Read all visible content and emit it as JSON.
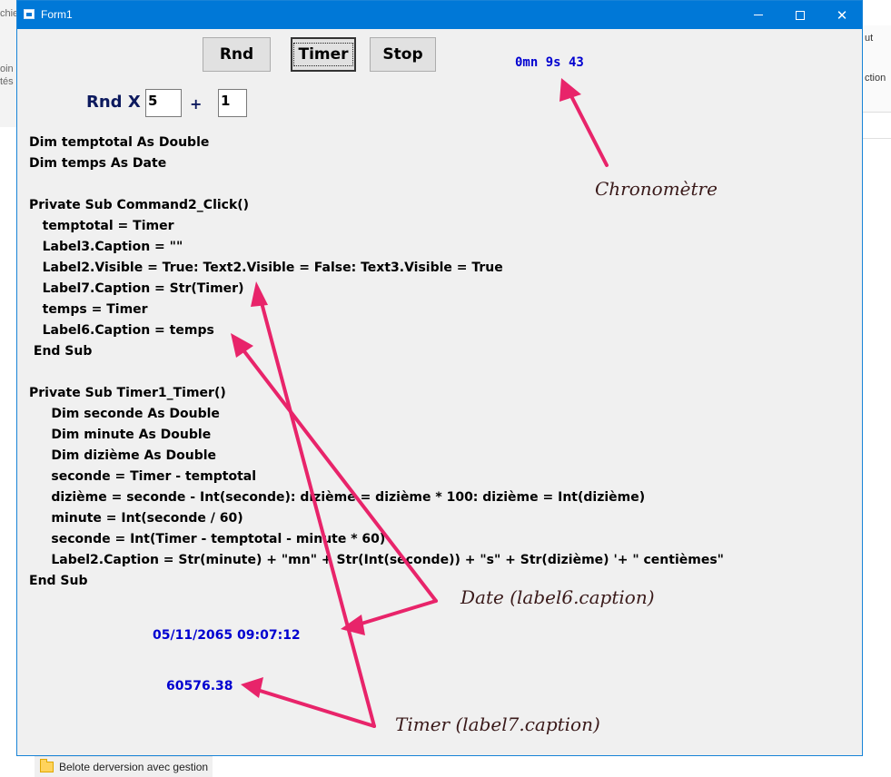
{
  "window": {
    "title": "Form1"
  },
  "background": {
    "left_texts": [
      "chie",
      "oin",
      "tés"
    ],
    "right_texts": [
      "ut",
      "ction"
    ],
    "taskbar_item": "Belote derversion avec gestion"
  },
  "buttons": {
    "rnd": "Rnd",
    "timer": "Timer",
    "stop": "Stop"
  },
  "rnd_row": {
    "label": "Rnd X",
    "field1": "5",
    "plus": "+",
    "field2": "1"
  },
  "chrono_display": "0mn 9s 43",
  "code_lines": [
    "Dim temptotal As Double",
    "Dim temps As Date",
    "",
    "Private Sub Command2_Click()",
    "   temptotal = Timer",
    "   Label3.Caption = \"\"",
    "   Label2.Visible = True: Text2.Visible = False: Text3.Visible = True",
    "   Label7.Caption = Str(Timer)",
    "   temps = Timer",
    "   Label6.Caption = temps",
    " End Sub",
    "",
    "Private Sub Timer1_Timer()",
    "     Dim seconde As Double",
    "     Dim minute As Double",
    "     Dim dizième As Double",
    "     seconde = Timer - temptotal",
    "     dizième = seconde - Int(seconde): dizième = dizième * 100: dizième = Int(dizième)",
    "     minute = Int(seconde / 60)",
    "     seconde = Int(Timer - temptotal - minute * 60)",
    "     Label2.Caption = Str(minute) + \"mn\" + Str(Int(seconde)) + \"s\" + Str(dizième) '+ \" centièmes\"",
    "End Sub"
  ],
  "date_label": "05/11/2065 09:07:12",
  "timer_label": "60576.38",
  "annotations": {
    "chrono": "Chronomètre",
    "date": "Date (label6.caption)",
    "timer": "Timer (label7.caption)"
  },
  "colors": {
    "titlebar": "#0078d7",
    "arrow": "#e8246a",
    "label_blue": "#0000d0"
  }
}
